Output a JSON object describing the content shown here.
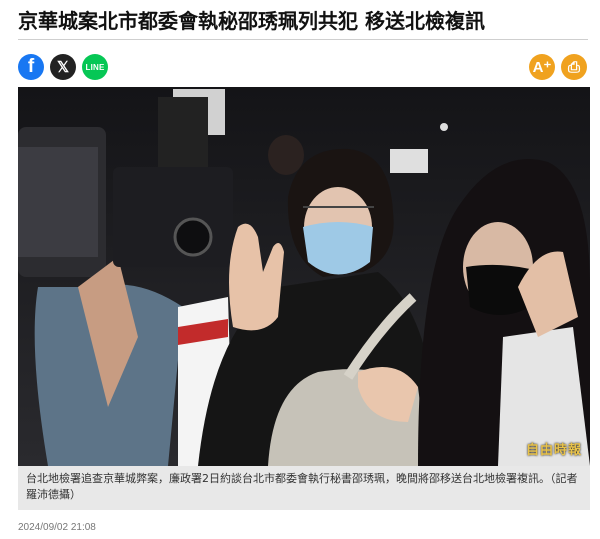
{
  "article": {
    "headline": "京華城案北市都委會執秘邵琇珮列共犯 移送北檢複訊",
    "caption": "台北地檢署追查京華城弊案，廉政署2日約談台北市都委會執行秘書邵琇珮，晚間將邵移送台北地檢署複訊。（記者羅沛德攝）",
    "timestamp": "2024/09/02 21:08",
    "photo_watermark": "自由時報"
  },
  "share": {
    "facebook": {
      "icon": "facebook-icon",
      "glyph": "f",
      "color": "#1877f2"
    },
    "x": {
      "icon": "x-icon",
      "glyph": "𝕏",
      "color": "#222222"
    },
    "line": {
      "icon": "line-icon",
      "glyph": "LINE",
      "color": "#06c755"
    }
  },
  "tools": {
    "font_size": {
      "icon": "font-size-icon",
      "glyph": "A⁺",
      "color": "#f0a21f"
    },
    "print": {
      "icon": "print-icon",
      "glyph": "⎙",
      "color": "#f0a21f"
    }
  }
}
